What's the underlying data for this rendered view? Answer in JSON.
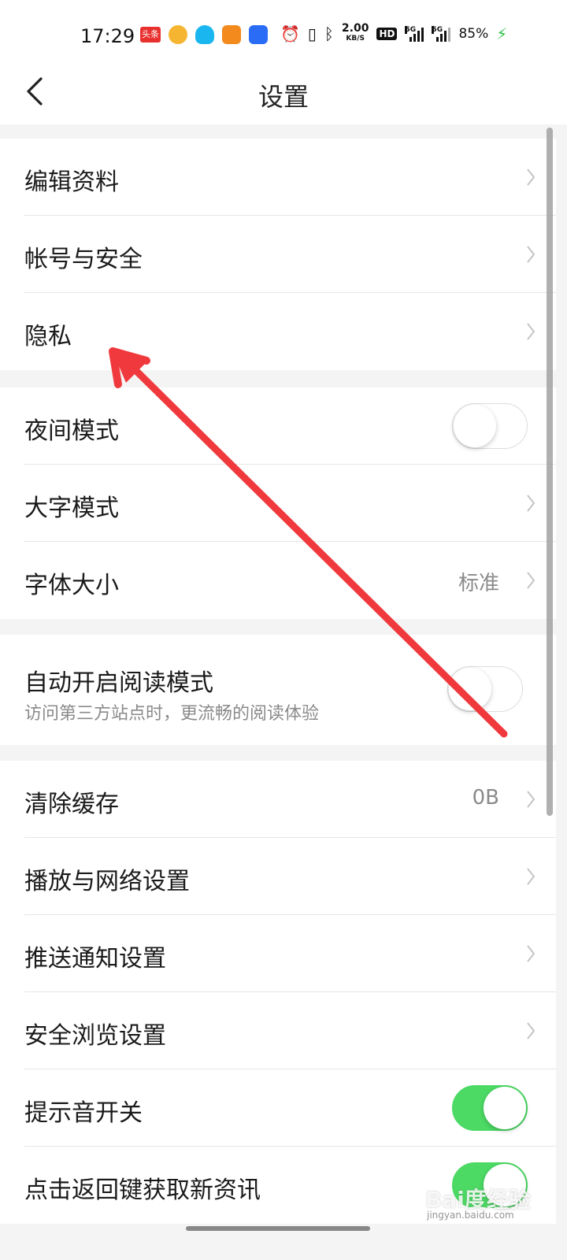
{
  "status_bar": {
    "time": "17:29",
    "app_icons": [
      "toutiao-icon",
      "weibo-icon",
      "qq-icon",
      "taobao-icon",
      "app-icon"
    ],
    "toutiao_text": "头条",
    "net_speed": "2.00",
    "net_unit": "KB/S",
    "hd_badge": "HD",
    "signal1_label": "5G",
    "signal2_label": "5G",
    "battery": "85%"
  },
  "nav": {
    "title": "设置"
  },
  "groups": [
    {
      "items": [
        {
          "label": "编辑资料",
          "type": "link"
        },
        {
          "label": "帐号与安全",
          "type": "link"
        },
        {
          "label": "隐私",
          "type": "link"
        }
      ]
    },
    {
      "items": [
        {
          "label": "夜间模式",
          "type": "toggle",
          "on": false
        },
        {
          "label": "大字模式",
          "type": "link"
        },
        {
          "label": "字体大小",
          "type": "link",
          "value": "标准"
        }
      ]
    },
    {
      "items": [
        {
          "label": "自动开启阅读模式",
          "sub": "访问第三方站点时，更流畅的阅读体验",
          "type": "toggle",
          "on": false
        }
      ]
    },
    {
      "items": [
        {
          "label": "清除缓存",
          "type": "link",
          "value": "0B"
        },
        {
          "label": "播放与网络设置",
          "type": "link"
        },
        {
          "label": "推送通知设置",
          "type": "link"
        },
        {
          "label": "安全浏览设置",
          "type": "link"
        },
        {
          "label": "提示音开关",
          "type": "toggle",
          "on": true
        },
        {
          "label": "点击返回键获取新资讯",
          "type": "toggle",
          "on": true
        }
      ]
    }
  ],
  "watermark": {
    "text": "Bai度经验",
    "sub": "jingyan.baidu.com"
  },
  "colors": {
    "toggle_on": "#4cd964",
    "annotation_arrow": "#f0393c",
    "background": "#f4f4f4"
  }
}
